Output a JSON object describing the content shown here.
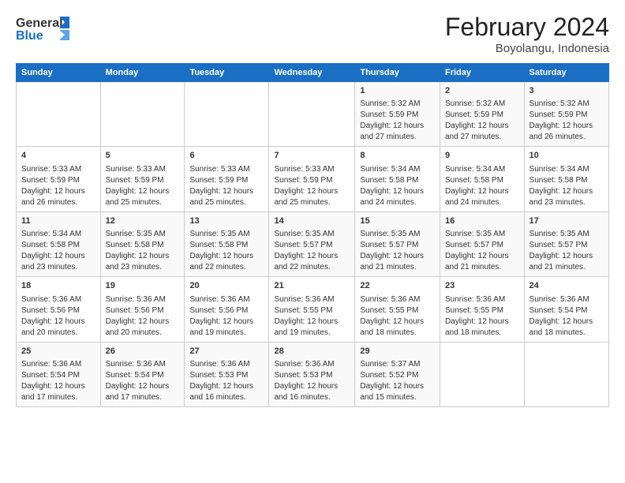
{
  "header": {
    "logo_line1": "General",
    "logo_line2": "Blue",
    "main_title": "February 2024",
    "subtitle": "Boyolangu, Indonesia"
  },
  "days_of_week": [
    "Sunday",
    "Monday",
    "Tuesday",
    "Wednesday",
    "Thursday",
    "Friday",
    "Saturday"
  ],
  "weeks": [
    {
      "cells": [
        {
          "day": "",
          "text": ""
        },
        {
          "day": "",
          "text": ""
        },
        {
          "day": "",
          "text": ""
        },
        {
          "day": "",
          "text": ""
        },
        {
          "day": "1",
          "text": "Sunrise: 5:32 AM\nSunset: 5:59 PM\nDaylight: 12 hours\nand 27 minutes."
        },
        {
          "day": "2",
          "text": "Sunrise: 5:32 AM\nSunset: 5:59 PM\nDaylight: 12 hours\nand 27 minutes."
        },
        {
          "day": "3",
          "text": "Sunrise: 5:32 AM\nSunset: 5:59 PM\nDaylight: 12 hours\nand 26 minutes."
        }
      ]
    },
    {
      "cells": [
        {
          "day": "4",
          "text": "Sunrise: 5:33 AM\nSunset: 5:59 PM\nDaylight: 12 hours\nand 26 minutes."
        },
        {
          "day": "5",
          "text": "Sunrise: 5:33 AM\nSunset: 5:59 PM\nDaylight: 12 hours\nand 25 minutes."
        },
        {
          "day": "6",
          "text": "Sunrise: 5:33 AM\nSunset: 5:59 PM\nDaylight: 12 hours\nand 25 minutes."
        },
        {
          "day": "7",
          "text": "Sunrise: 5:33 AM\nSunset: 5:59 PM\nDaylight: 12 hours\nand 25 minutes."
        },
        {
          "day": "8",
          "text": "Sunrise: 5:34 AM\nSunset: 5:58 PM\nDaylight: 12 hours\nand 24 minutes."
        },
        {
          "day": "9",
          "text": "Sunrise: 5:34 AM\nSunset: 5:58 PM\nDaylight: 12 hours\nand 24 minutes."
        },
        {
          "day": "10",
          "text": "Sunrise: 5:34 AM\nSunset: 5:58 PM\nDaylight: 12 hours\nand 23 minutes."
        }
      ]
    },
    {
      "cells": [
        {
          "day": "11",
          "text": "Sunrise: 5:34 AM\nSunset: 5:58 PM\nDaylight: 12 hours\nand 23 minutes."
        },
        {
          "day": "12",
          "text": "Sunrise: 5:35 AM\nSunset: 5:58 PM\nDaylight: 12 hours\nand 23 minutes."
        },
        {
          "day": "13",
          "text": "Sunrise: 5:35 AM\nSunset: 5:58 PM\nDaylight: 12 hours\nand 22 minutes."
        },
        {
          "day": "14",
          "text": "Sunrise: 5:35 AM\nSunset: 5:57 PM\nDaylight: 12 hours\nand 22 minutes."
        },
        {
          "day": "15",
          "text": "Sunrise: 5:35 AM\nSunset: 5:57 PM\nDaylight: 12 hours\nand 21 minutes."
        },
        {
          "day": "16",
          "text": "Sunrise: 5:35 AM\nSunset: 5:57 PM\nDaylight: 12 hours\nand 21 minutes."
        },
        {
          "day": "17",
          "text": "Sunrise: 5:35 AM\nSunset: 5:57 PM\nDaylight: 12 hours\nand 21 minutes."
        }
      ]
    },
    {
      "cells": [
        {
          "day": "18",
          "text": "Sunrise: 5:36 AM\nSunset: 5:56 PM\nDaylight: 12 hours\nand 20 minutes."
        },
        {
          "day": "19",
          "text": "Sunrise: 5:36 AM\nSunset: 5:56 PM\nDaylight: 12 hours\nand 20 minutes."
        },
        {
          "day": "20",
          "text": "Sunrise: 5:36 AM\nSunset: 5:56 PM\nDaylight: 12 hours\nand 19 minutes."
        },
        {
          "day": "21",
          "text": "Sunrise: 5:36 AM\nSunset: 5:55 PM\nDaylight: 12 hours\nand 19 minutes."
        },
        {
          "day": "22",
          "text": "Sunrise: 5:36 AM\nSunset: 5:55 PM\nDaylight: 12 hours\nand 18 minutes."
        },
        {
          "day": "23",
          "text": "Sunrise: 5:36 AM\nSunset: 5:55 PM\nDaylight: 12 hours\nand 18 minutes."
        },
        {
          "day": "24",
          "text": "Sunrise: 5:36 AM\nSunset: 5:54 PM\nDaylight: 12 hours\nand 18 minutes."
        }
      ]
    },
    {
      "cells": [
        {
          "day": "25",
          "text": "Sunrise: 5:36 AM\nSunset: 5:54 PM\nDaylight: 12 hours\nand 17 minutes."
        },
        {
          "day": "26",
          "text": "Sunrise: 5:36 AM\nSunset: 5:54 PM\nDaylight: 12 hours\nand 17 minutes."
        },
        {
          "day": "27",
          "text": "Sunrise: 5:36 AM\nSunset: 5:53 PM\nDaylight: 12 hours\nand 16 minutes."
        },
        {
          "day": "28",
          "text": "Sunrise: 5:36 AM\nSunset: 5:53 PM\nDaylight: 12 hours\nand 16 minutes."
        },
        {
          "day": "29",
          "text": "Sunrise: 5:37 AM\nSunset: 5:52 PM\nDaylight: 12 hours\nand 15 minutes."
        },
        {
          "day": "",
          "text": ""
        },
        {
          "day": "",
          "text": ""
        }
      ]
    }
  ]
}
